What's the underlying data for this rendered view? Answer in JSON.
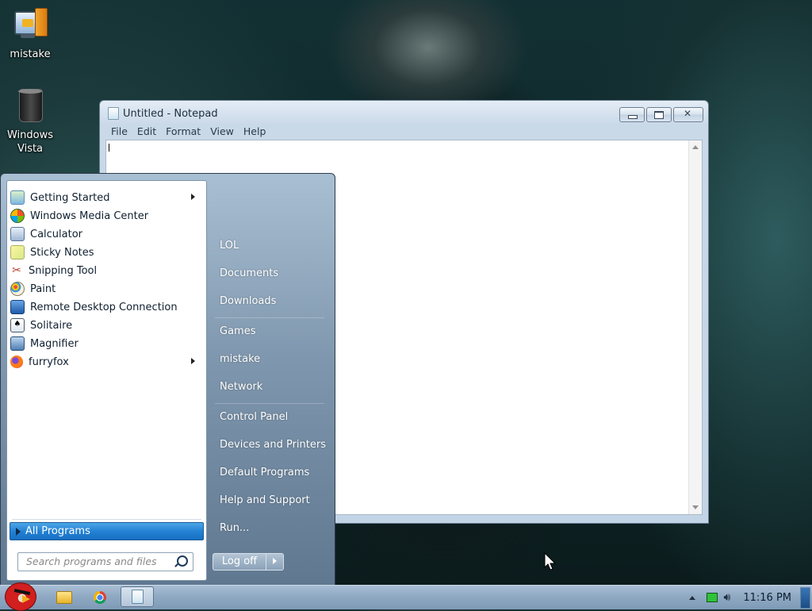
{
  "desktop": {
    "icons": [
      {
        "label": "mistake"
      },
      {
        "label": "Windows Vista"
      }
    ]
  },
  "notepad": {
    "title": "Untitled - Notepad",
    "menu": [
      "File",
      "Edit",
      "Format",
      "View",
      "Help"
    ]
  },
  "start_menu": {
    "pinned": [
      {
        "label": "Getting Started",
        "submenu": true
      },
      {
        "label": "Windows Media Center",
        "submenu": false
      },
      {
        "label": "Calculator",
        "submenu": false
      },
      {
        "label": "Sticky Notes",
        "submenu": false
      },
      {
        "label": "Snipping Tool",
        "submenu": false
      },
      {
        "label": "Paint",
        "submenu": false
      },
      {
        "label": "Remote Desktop Connection",
        "submenu": false
      },
      {
        "label": "Solitaire",
        "submenu": false
      },
      {
        "label": "Magnifier",
        "submenu": false
      },
      {
        "label": "furryfox",
        "submenu": true
      }
    ],
    "all_programs": "All Programs",
    "search_placeholder": "Search programs and files",
    "right": [
      "LOL",
      "Documents",
      "Downloads",
      "Games",
      "mistake",
      "Network",
      "Control Panel",
      "Devices and Printers",
      "Default Programs",
      "Help and Support",
      "Run..."
    ],
    "logoff": "Log off"
  },
  "taskbar": {
    "clock": "11:16 PM"
  }
}
